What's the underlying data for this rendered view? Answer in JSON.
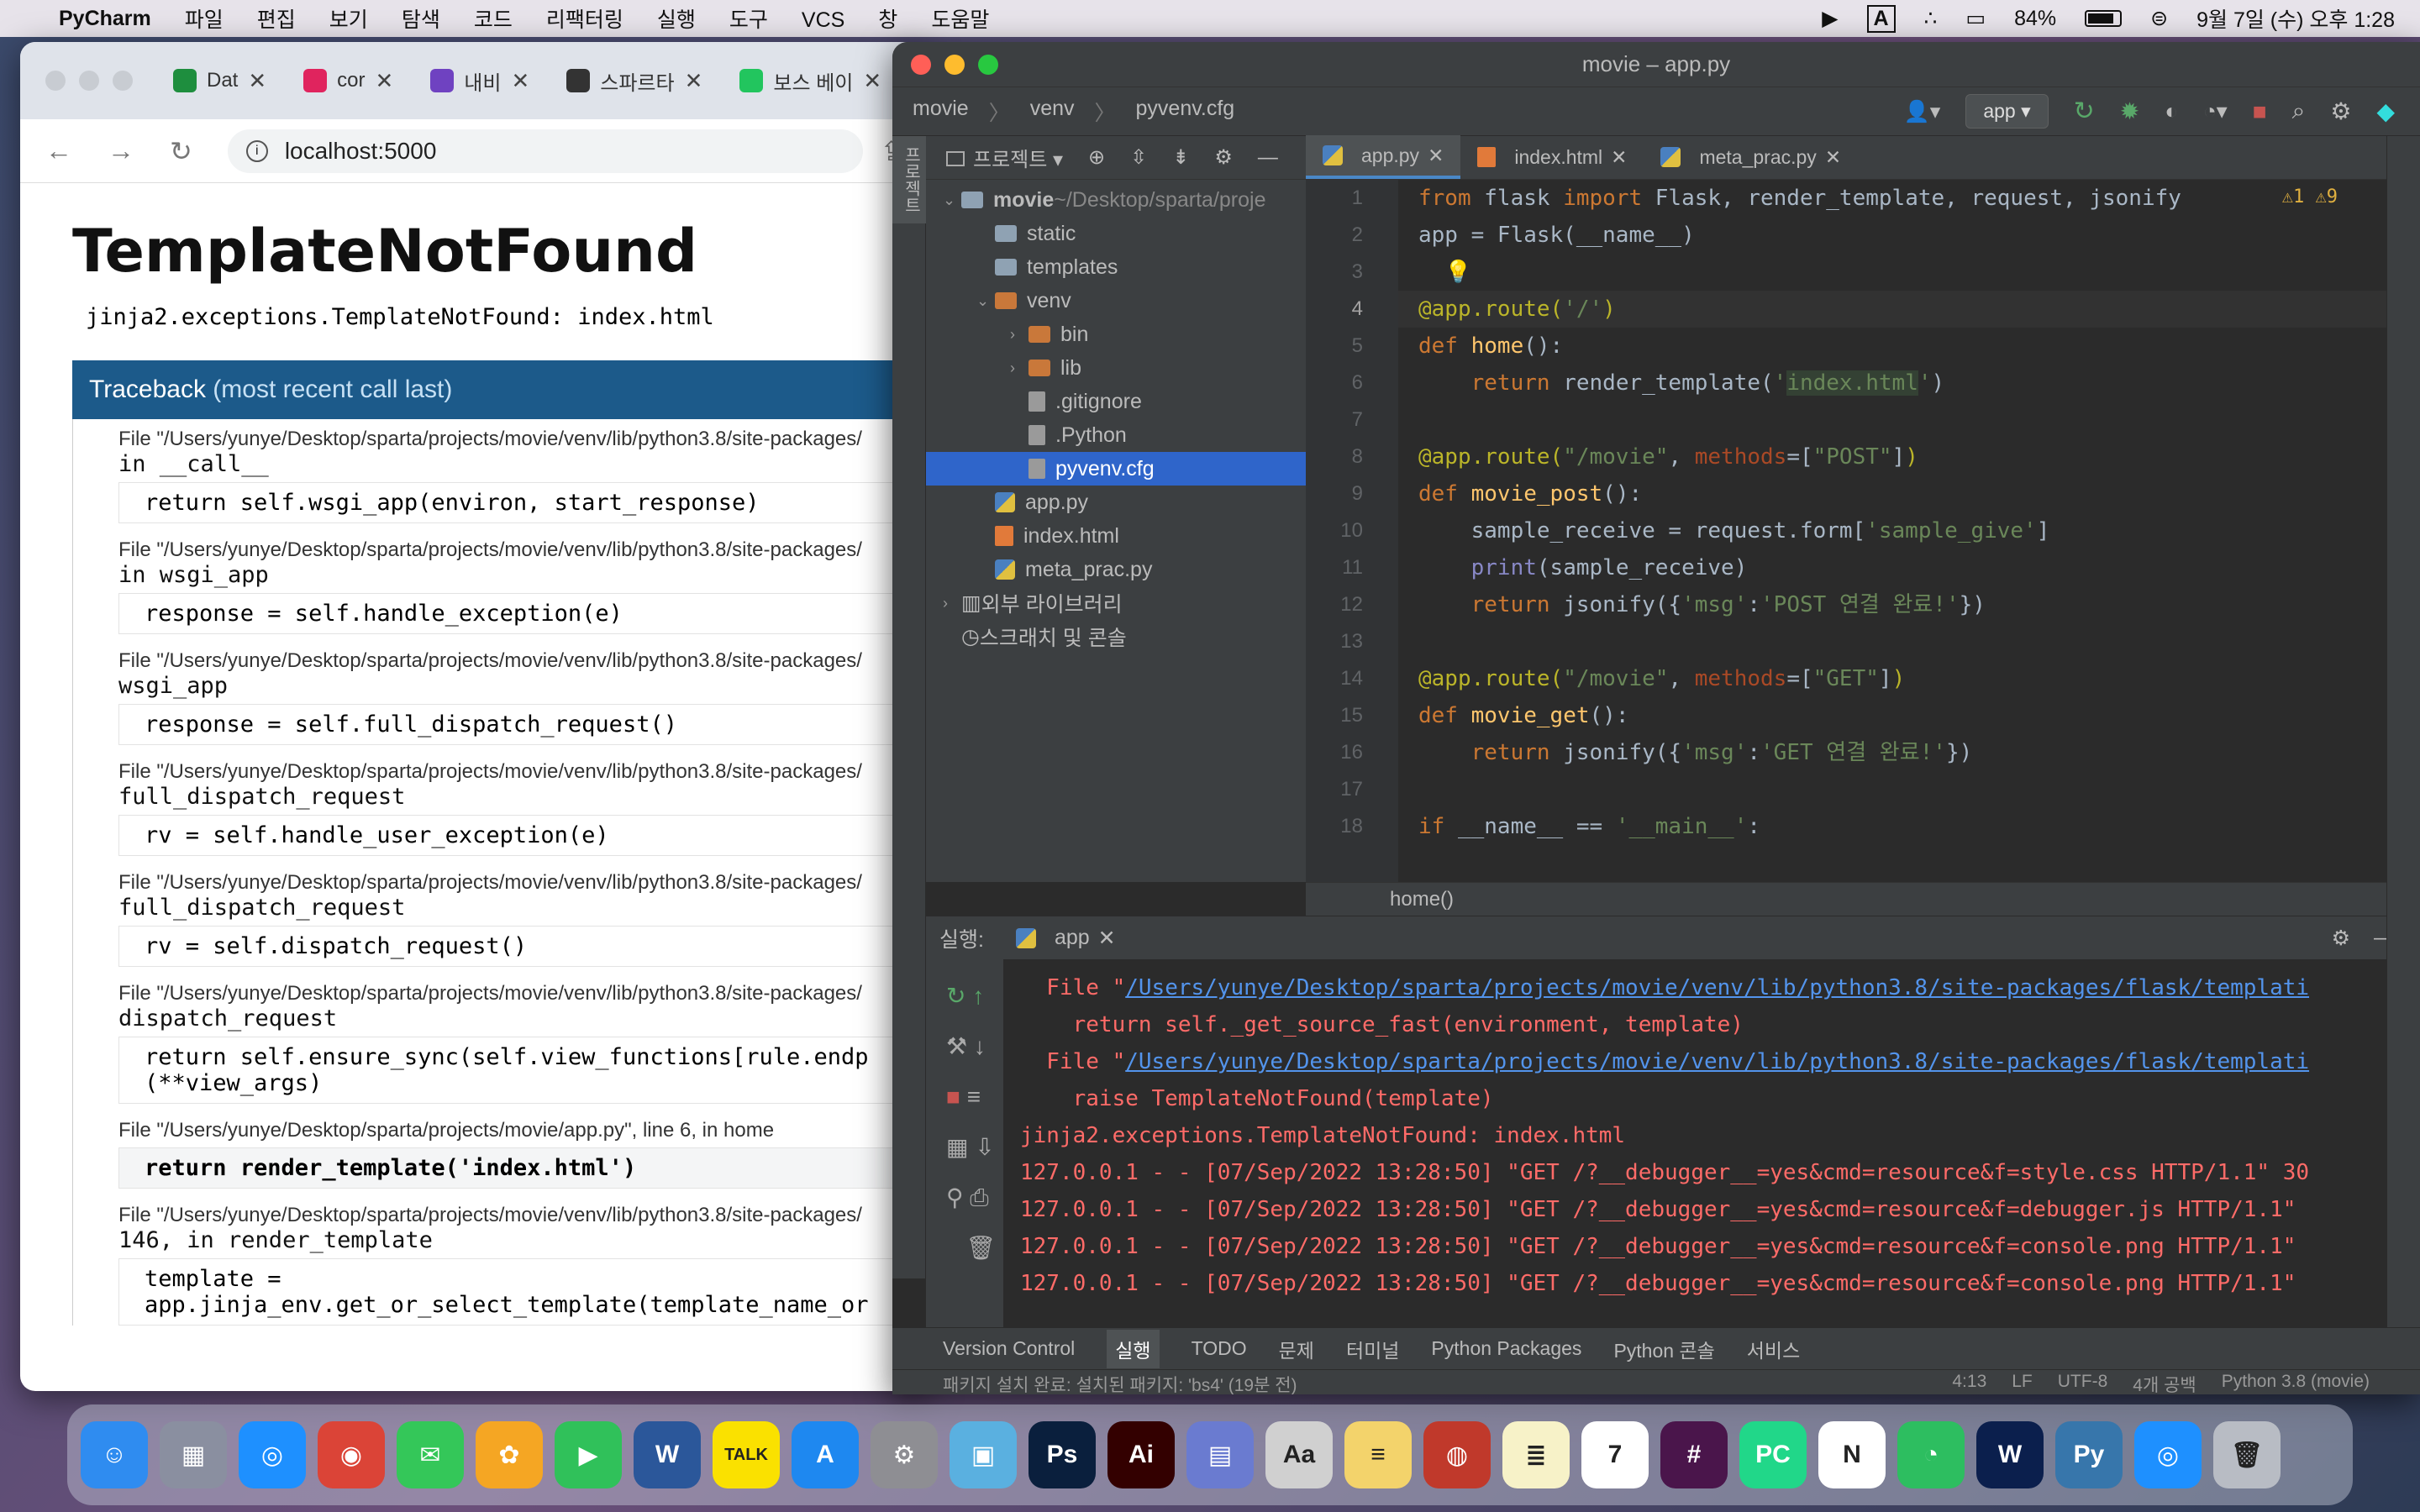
{
  "menubar": {
    "app": "PyCharm",
    "menus": [
      "파일",
      "편집",
      "보기",
      "탐색",
      "코드",
      "리팩터링",
      "실행",
      "도구",
      "VCS",
      "창",
      "도움말"
    ],
    "battery": "84%",
    "clock": "9월 7일 (수) 오후 1:28",
    "input_source": "A"
  },
  "browser": {
    "tabs": [
      {
        "label": "Dat",
        "color": "#1e8e3e"
      },
      {
        "label": "cor",
        "color": "#e0245e"
      },
      {
        "label": "내비",
        "color": "#6f42c1"
      },
      {
        "label": "스파르타",
        "color": "#333333"
      },
      {
        "label": "보스 베이",
        "color": "#22c55e"
      }
    ],
    "url": "localhost:5000",
    "error_title": "TemplateNotFound",
    "error_message": "jinja2.exceptions.TemplateNotFound: index.html",
    "traceback_head": "Traceback",
    "traceback_sub": "(most recent call last)",
    "frames": [
      {
        "path": "File \"/Users/yunye/Desktop/sparta/projects/movie/venv/lib/python3.8/site-packages/",
        "fn": "in __call__",
        "code": "return self.wsgi_app(environ, start_response)"
      },
      {
        "path": "File \"/Users/yunye/Desktop/sparta/projects/movie/venv/lib/python3.8/site-packages/",
        "fn": "in wsgi_app",
        "code": "response = self.handle_exception(e)"
      },
      {
        "path": "File \"/Users/yunye/Desktop/sparta/projects/movie/venv/lib/python3.8/site-packages/",
        "fn": "wsgi_app",
        "code": "response = self.full_dispatch_request()"
      },
      {
        "path": "File \"/Users/yunye/Desktop/sparta/projects/movie/venv/lib/python3.8/site-packages/",
        "fn": "full_dispatch_request",
        "code": "rv = self.handle_user_exception(e)"
      },
      {
        "path": "File \"/Users/yunye/Desktop/sparta/projects/movie/venv/lib/python3.8/site-packages/",
        "fn": "full_dispatch_request",
        "code": "rv = self.dispatch_request()"
      },
      {
        "path": "File \"/Users/yunye/Desktop/sparta/projects/movie/venv/lib/python3.8/site-packages/",
        "fn": "dispatch_request",
        "code": "return self.ensure_sync(self.view_functions[rule.endp\n(**view_args)"
      },
      {
        "path": "File \"/Users/yunye/Desktop/sparta/projects/movie/app.py\", line 6, in home",
        "fn": "",
        "code": "return render_template('index.html')",
        "highlight": true
      },
      {
        "path": "File \"/Users/yunye/Desktop/sparta/projects/movie/venv/lib/python3.8/site-packages/",
        "fn": "146, in render_template",
        "code": "template =\napp.jinja_env.get_or_select_template(template_name_or"
      }
    ]
  },
  "ide": {
    "title": "movie – app.py",
    "breadcrumbs": [
      "movie",
      "venv",
      "pyvenv.cfg"
    ],
    "run_config": "app",
    "project_label": "프로젝트",
    "tree": [
      {
        "label": "movie",
        "suffix": " ~/Desktop/sparta/proje",
        "indent": 0,
        "arrow": "v",
        "type": "folder"
      },
      {
        "label": "static",
        "indent": 1,
        "arrow": "",
        "type": "folder"
      },
      {
        "label": "templates",
        "indent": 1,
        "arrow": "",
        "type": "folder"
      },
      {
        "label": "venv",
        "indent": 1,
        "arrow": "v",
        "type": "folder-orange"
      },
      {
        "label": "bin",
        "indent": 2,
        "arrow": ">",
        "type": "folder-orange"
      },
      {
        "label": "lib",
        "indent": 2,
        "arrow": ">",
        "type": "folder-orange"
      },
      {
        "label": ".gitignore",
        "indent": 2,
        "arrow": "",
        "type": "file"
      },
      {
        "label": ".Python",
        "indent": 2,
        "arrow": "",
        "type": "file"
      },
      {
        "label": "pyvenv.cfg",
        "indent": 2,
        "arrow": "",
        "type": "file",
        "selected": true
      },
      {
        "label": "app.py",
        "indent": 1,
        "arrow": "",
        "type": "py"
      },
      {
        "label": "index.html",
        "indent": 1,
        "arrow": "",
        "type": "html"
      },
      {
        "label": "meta_prac.py",
        "indent": 1,
        "arrow": "",
        "type": "py"
      },
      {
        "label": "외부 라이브러리",
        "indent": 0,
        "arrow": ">",
        "type": "lib"
      },
      {
        "label": "스크래치 및 콘솔",
        "indent": 0,
        "arrow": "",
        "type": "scratch"
      }
    ],
    "editor_tabs": [
      {
        "label": "app.py",
        "active": true
      },
      {
        "label": "index.html",
        "active": false
      },
      {
        "label": "meta_prac.py",
        "active": false
      }
    ],
    "inspections": "⚠1 ⚠9",
    "code_footer": "home()",
    "run_label": "실행:",
    "run_tab": "app",
    "output": [
      {
        "text": "  File \"",
        "link": "/Users/yunye/Desktop/sparta/projects/movie/venv/lib/python3.8/site-packages/flask/templati",
        "after": ""
      },
      {
        "text": "    return self._get_source_fast(environment, template)"
      },
      {
        "text": "  File \"",
        "link": "/Users/yunye/Desktop/sparta/projects/movie/venv/lib/python3.8/site-packages/flask/templati",
        "after": ""
      },
      {
        "text": "    raise TemplateNotFound(template)"
      },
      {
        "text": "jinja2.exceptions.TemplateNotFound: index.html"
      },
      {
        "text": "127.0.0.1 - - [07/Sep/2022 13:28:50] \"GET /?__debugger__=yes&cmd=resource&f=style.css HTTP/1.1\" 30"
      },
      {
        "text": "127.0.0.1 - - [07/Sep/2022 13:28:50] \"GET /?__debugger__=yes&cmd=resource&f=debugger.js HTTP/1.1\""
      },
      {
        "text": "127.0.0.1 - - [07/Sep/2022 13:28:50] \"GET /?__debugger__=yes&cmd=resource&f=console.png HTTP/1.1\""
      },
      {
        "text": "127.0.0.1 - - [07/Sep/2022 13:28:50] \"GET /?__debugger__=yes&cmd=resource&f=console.png HTTP/1.1\""
      }
    ],
    "bottom_tabs": [
      "Version Control",
      "실행",
      "TODO",
      "문제",
      "터미널",
      "Python Packages",
      "Python 콘솔",
      "서비스"
    ],
    "status_left": "패키지 설치 완료: 설치된 패키지: 'bs4' (19분 전)",
    "status_right": [
      "4:13",
      "LF",
      "UTF-8",
      "4개 공백",
      "Python 3.8 (movie)"
    ]
  },
  "dock": {
    "apps": [
      {
        "name": "finder",
        "color": "#2f8cf0",
        "glyph": "☺"
      },
      {
        "name": "launchpad",
        "color": "#8a8fa0",
        "glyph": "▦"
      },
      {
        "name": "safari",
        "color": "#1e90ff",
        "glyph": "◎"
      },
      {
        "name": "chrome",
        "color": "#db4437",
        "glyph": "◉"
      },
      {
        "name": "messages",
        "color": "#34c759",
        "glyph": "✉"
      },
      {
        "name": "photos",
        "color": "#f5a623",
        "glyph": "✿"
      },
      {
        "name": "facetime",
        "color": "#30c15a",
        "glyph": "▶"
      },
      {
        "name": "word",
        "color": "#2b579a",
        "glyph": "W"
      },
      {
        "name": "kakaotalk",
        "color": "#fae100",
        "glyph": "TALK"
      },
      {
        "name": "app-store",
        "color": "#1e88f0",
        "glyph": "A"
      },
      {
        "name": "system-preferences",
        "color": "#8e8e93",
        "glyph": "⚙"
      },
      {
        "name": "preview",
        "color": "#5ab0e0",
        "glyph": "▣"
      },
      {
        "name": "photoshop",
        "color": "#0a1f3d",
        "glyph": "Ps"
      },
      {
        "name": "illustrator",
        "color": "#330000",
        "glyph": "Ai"
      },
      {
        "name": "image-capture",
        "color": "#6a7bd0",
        "glyph": "▤"
      },
      {
        "name": "dictionary",
        "color": "#d0d0d0",
        "glyph": "Aa"
      },
      {
        "name": "stickies",
        "color": "#f3d36b",
        "glyph": "≡"
      },
      {
        "name": "photo-booth",
        "color": "#c0392b",
        "glyph": "◍"
      },
      {
        "name": "notes",
        "color": "#f7f2c8",
        "glyph": "≣"
      },
      {
        "name": "calendar",
        "color": "#ffffff",
        "glyph": "7"
      },
      {
        "name": "slack",
        "color": "#4a154b",
        "glyph": "#"
      },
      {
        "name": "pycharm",
        "color": "#21d789",
        "glyph": "PC"
      },
      {
        "name": "notion",
        "color": "#ffffff",
        "glyph": "N"
      },
      {
        "name": "evernote-like",
        "color": "#2dbe60",
        "glyph": "◔"
      },
      {
        "name": "webex",
        "color": "#0b1f4d",
        "glyph": "W"
      },
      {
        "name": "python-launcher",
        "color": "#3776ab",
        "glyph": "Py"
      },
      {
        "name": "safari-2",
        "color": "#1e90ff",
        "glyph": "◎"
      },
      {
        "name": "trash",
        "color": "#b8bcc4",
        "glyph": "🗑"
      }
    ]
  }
}
